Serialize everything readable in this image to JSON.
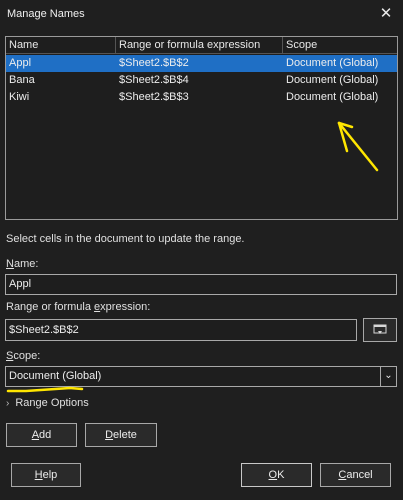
{
  "window": {
    "title": "Manage Names",
    "close_glyph": "✕"
  },
  "table": {
    "columns": [
      "Name",
      "Range or formula expression",
      "Scope"
    ],
    "rows": [
      {
        "name": "Appl",
        "range": "$Sheet2.$B$2",
        "scope": "Document (Global)"
      },
      {
        "name": "Bana",
        "range": "$Sheet2.$B$4",
        "scope": "Document (Global)"
      },
      {
        "name": "Kiwi",
        "range": "$Sheet2.$B$3",
        "scope": "Document (Global)"
      }
    ],
    "selected_row": 0
  },
  "hint": "Select cells in the document to update the range.",
  "fields": {
    "name": {
      "label_u": "N",
      "label_rest": "ame:",
      "value": "Appl"
    },
    "range": {
      "label_before": "Range or formula ",
      "label_u": "e",
      "label_after": "xpression:",
      "value": "$Sheet2.$B$2"
    },
    "scope": {
      "label_u": "S",
      "label_rest": "cope:",
      "value": "Document (Global)"
    }
  },
  "range_options": {
    "label": "Range Options"
  },
  "buttons": {
    "add": {
      "u": "A",
      "rest": "dd"
    },
    "delete": {
      "u": "D",
      "rest": "elete"
    },
    "help": {
      "u": "H",
      "rest": "elp"
    },
    "ok": {
      "u": "O",
      "rest": "K"
    },
    "cancel": {
      "u": "C",
      "rest": "ancel"
    }
  },
  "colors": {
    "selection": "#1f6fc5",
    "annotation": "#ffe600",
    "background": "#1f1f1f"
  },
  "icons": {
    "close": "close-icon",
    "collapse": "chevron-down-icon",
    "expander": "chevron-right-icon",
    "shrink": "shrink-dialog-icon"
  }
}
